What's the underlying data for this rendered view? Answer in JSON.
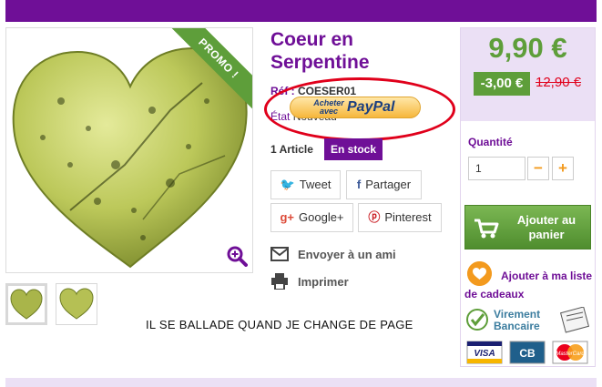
{
  "product": {
    "title": "Coeur en Serpentine",
    "ref_label": "Réf :",
    "ref_value": "COESER01",
    "state_label": "État",
    "state_value": "Nouveau",
    "article_count": "1 Article",
    "stock_status": "En stock",
    "promo_label": "PROMO !"
  },
  "paypal": {
    "small_text": "Acheter avec",
    "logo_text": "PayPal"
  },
  "share": {
    "tweet": "Tweet",
    "share": "Partager",
    "google": "Google+",
    "pinterest": "Pinterest"
  },
  "actions": {
    "send_friend": "Envoyer à un ami",
    "print": "Imprimer"
  },
  "caption": "IL SE BALLADE QUAND JE CHANGE DE PAGE",
  "buy_box": {
    "price": "9,90 €",
    "discount": "-3,00 €",
    "old_price": "12,90 €",
    "quantity_label": "Quantité",
    "quantity_value": "1",
    "minus": "−",
    "plus": "+",
    "add_to_cart": "Ajouter au panier",
    "wishlist": "Ajouter à ma liste de cadeaux",
    "transfer_title": "Virement",
    "transfer_sub": "Bancaire",
    "cards": [
      "VISA",
      "CB",
      "MasterCard"
    ]
  },
  "colors": {
    "brand_purple": "#6f0f97",
    "light_purple": "#ebe0f5",
    "price_green": "#5e9e3a",
    "old_price_red": "#e0001b",
    "accent_orange": "#f39a1e"
  },
  "icons": [
    "zoom-icon",
    "twitter-icon",
    "facebook-icon",
    "google-plus-icon",
    "pinterest-icon",
    "envelope-icon",
    "printer-icon",
    "cart-icon",
    "heart-icon"
  ]
}
